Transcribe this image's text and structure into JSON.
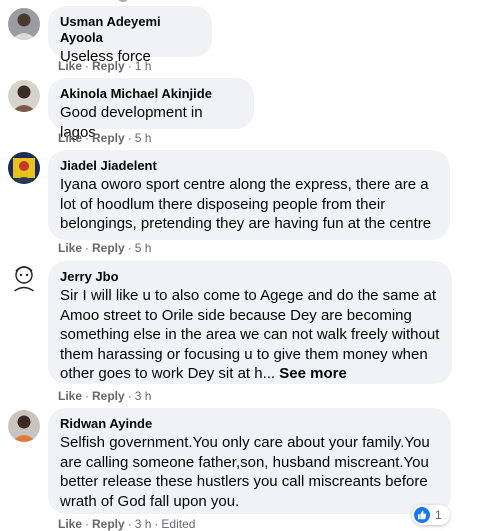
{
  "comments": [
    {
      "author": "Usman Adeyemi Ayoola",
      "text_lines": [
        "Useless force"
      ],
      "actions": {
        "like": "Like",
        "reply": "Reply",
        "time": "1 h"
      }
    },
    {
      "author": "Akinola Michael Akinjide",
      "text_lines": [
        "Good development in lagos"
      ],
      "actions": {
        "like": "Like",
        "reply": "Reply",
        "time": "5 h"
      }
    },
    {
      "author": "Jiadel Jiadelent",
      "text_lines": [
        "Iyana oworo sport centre along the express, there are a",
        "lot of hoodlum there disposeing people from their",
        "belongings, pretending they are having fun at the centre"
      ],
      "actions": {
        "like": "Like",
        "reply": "Reply",
        "time": "5 h"
      }
    },
    {
      "author": "Jerry Jbo",
      "text_lines": [
        "Sir I will like u to also come to Agege and do the same at",
        "Amoo street to Orile side because Dey are becoming",
        "something else in the area we can not walk freely without",
        "them harassing or focusing u to give them money when",
        "other goes to work Dey sit at h..."
      ],
      "see_more": "See more",
      "actions": {
        "like": "Like",
        "reply": "Reply",
        "time": "3 h"
      }
    },
    {
      "author": "Ridwan Ayinde",
      "text_lines": [
        "Selfish government.You only care about your family.You",
        "are calling someone father,son, husband miscreant.You",
        "better release these hustlers you call miscreants before",
        "wrath of God fall upon you."
      ],
      "actions": {
        "like": "Like",
        "reply": "Reply",
        "time": "3 h",
        "edited": "Edited"
      },
      "reactions": {
        "icon": "like-icon",
        "count": "1"
      }
    }
  ],
  "colors": {
    "bubble": "#f0f2f5",
    "meta": "#65676b",
    "like_blue": "#1877f2"
  }
}
